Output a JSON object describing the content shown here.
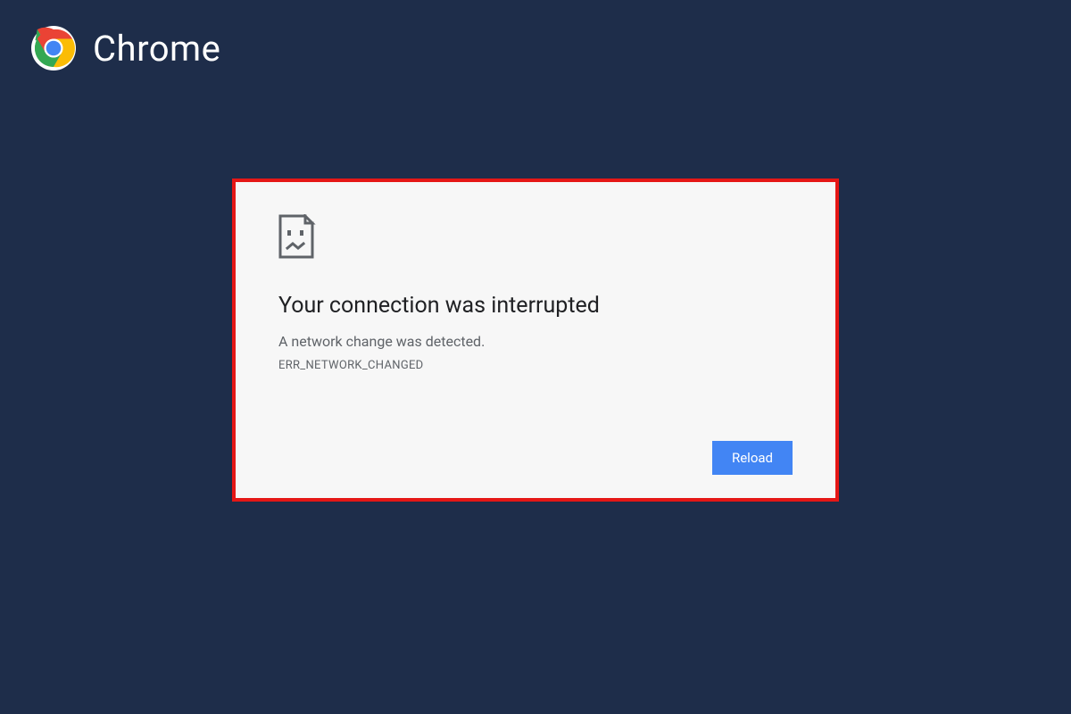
{
  "header": {
    "browser_name": "Chrome"
  },
  "error": {
    "heading": "Your connection was interrupted",
    "subtext": "A network change was detected.",
    "code": "ERR_NETWORK_CHANGED",
    "reload_label": "Reload"
  },
  "colors": {
    "background": "#1e2d4a",
    "panel_bg": "#f7f7f7",
    "panel_border": "#e51716",
    "button_bg": "#4285f4",
    "text_dark": "#202124",
    "text_muted": "#5f6368"
  }
}
